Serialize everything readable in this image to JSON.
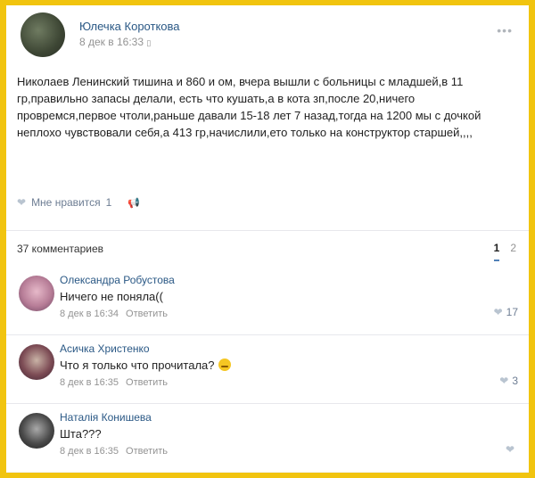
{
  "post": {
    "author": "Юлечка Короткова",
    "date": "8 дек в 16:33",
    "menu_icon": "more-dots-icon",
    "text": "Николаев Ленинский тишина и 860 и ом, вчера вышли с больницы с младшей,в 11 гр,правильно запасы делали, есть что кушать,а в кота зп,после 20,ничего провремся,первое чтоли,раньше давали 15-18 лет 7 назад,тогда на 1200 мы с дочкой неплохо чувствовали себя,а 413 гр,начислили,ето только на конструктор старшей,,,,",
    "like_label": "Мне нравится",
    "like_count": "1"
  },
  "comments_header": {
    "count_label": "37 комментариев",
    "pages": [
      "1",
      "2"
    ]
  },
  "comments": [
    {
      "name": "Олександра Робустова",
      "text": "Ничего не поняла((",
      "date": "8 дек в 16:34",
      "reply": "Ответить",
      "likes": "17"
    },
    {
      "name": "Асичка Христенко",
      "text": "Что я только что прочитала?",
      "date": "8 дек в 16:35",
      "reply": "Ответить",
      "likes": "3"
    },
    {
      "name": "Наталія Конишева",
      "text": "Шта???",
      "date": "8 дек в 16:35",
      "reply": "Ответить",
      "likes": ""
    }
  ]
}
